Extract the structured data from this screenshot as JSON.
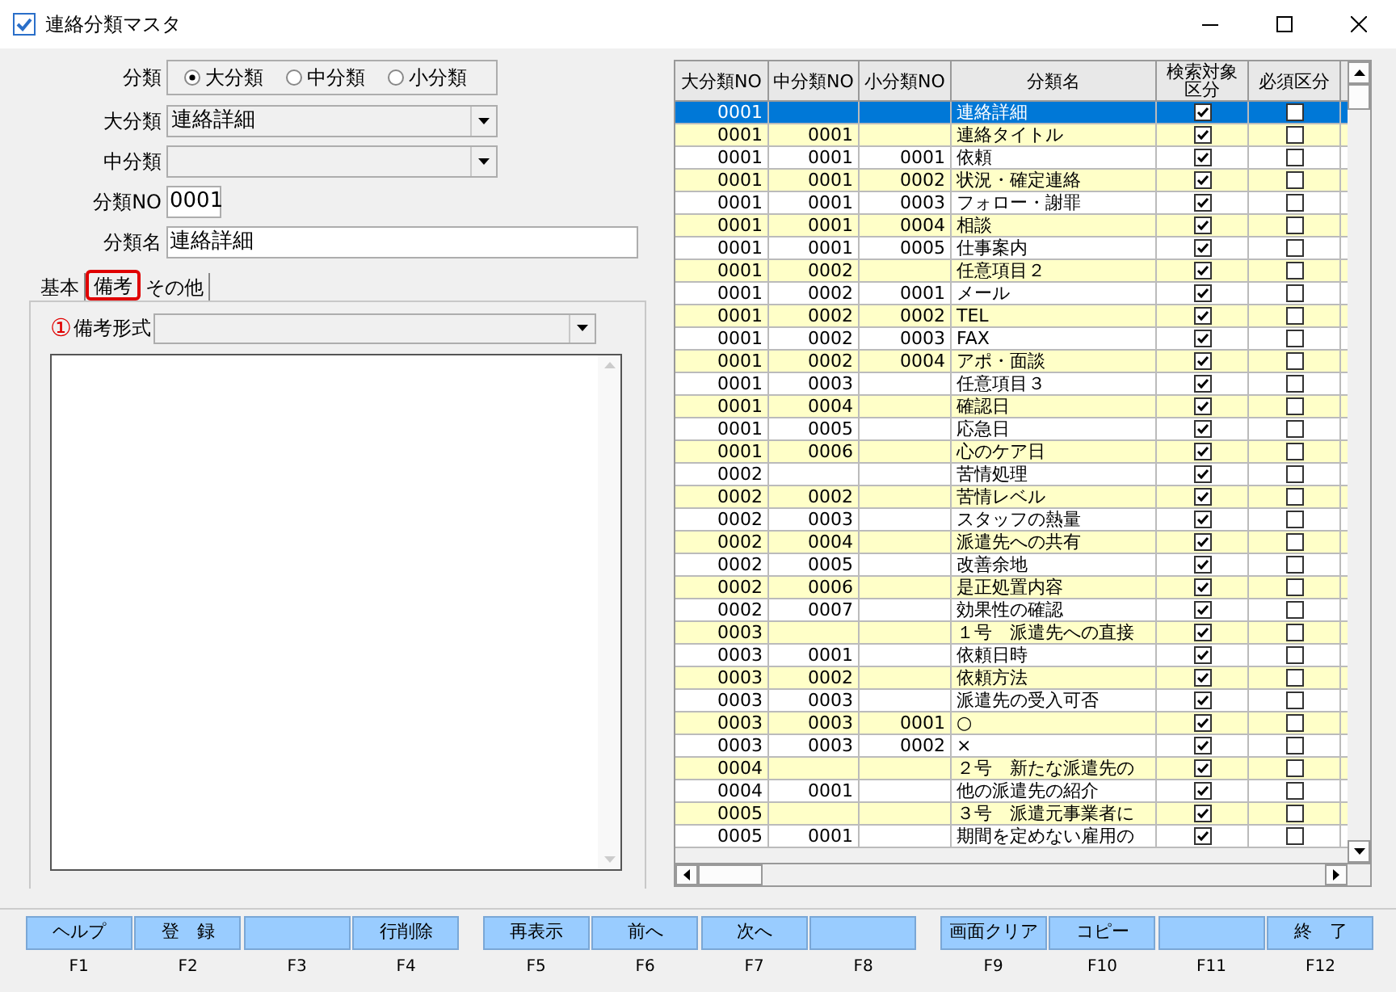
{
  "window": {
    "title": "連絡分類マスタ"
  },
  "form": {
    "category_label": "分類",
    "radios": [
      {
        "label": "大分類",
        "selected": true
      },
      {
        "label": "中分類",
        "selected": false
      },
      {
        "label": "小分類",
        "selected": false
      }
    ],
    "major_label": "大分類",
    "major_value": "連絡詳細",
    "middle_label": "中分類",
    "no_label": "分類NO",
    "no_value": "0001",
    "name_label": "分類名",
    "name_value": "連絡詳細"
  },
  "tabs": [
    {
      "label": "基本",
      "selected": false,
      "annotated": false
    },
    {
      "label": "備考",
      "selected": true,
      "annotated": true
    },
    {
      "label": "その他",
      "selected": false,
      "annotated": false
    }
  ],
  "remarks": {
    "marker": "①",
    "label": "備考形式"
  },
  "table": {
    "columns": [
      "大分類NO",
      "中分類NO",
      "小分類NO",
      "分類名",
      "検索対象区分",
      "必須区分"
    ],
    "rows": [
      {
        "major": "0001",
        "middle": "",
        "minor": "",
        "name": "連絡詳細",
        "search": true,
        "required": false,
        "selected": true
      },
      {
        "major": "0001",
        "middle": "0001",
        "minor": "",
        "name": "連絡タイトル",
        "search": true,
        "required": false,
        "selected": false
      },
      {
        "major": "0001",
        "middle": "0001",
        "minor": "0001",
        "name": "依頼",
        "search": true,
        "required": false,
        "selected": false
      },
      {
        "major": "0001",
        "middle": "0001",
        "minor": "0002",
        "name": "状況・確定連絡",
        "search": true,
        "required": false,
        "selected": false
      },
      {
        "major": "0001",
        "middle": "0001",
        "minor": "0003",
        "name": "フォロー・謝罪",
        "search": true,
        "required": false,
        "selected": false
      },
      {
        "major": "0001",
        "middle": "0001",
        "minor": "0004",
        "name": "相談",
        "search": true,
        "required": false,
        "selected": false
      },
      {
        "major": "0001",
        "middle": "0001",
        "minor": "0005",
        "name": "仕事案内",
        "search": true,
        "required": false,
        "selected": false
      },
      {
        "major": "0001",
        "middle": "0002",
        "minor": "",
        "name": "任意項目２",
        "search": true,
        "required": false,
        "selected": false
      },
      {
        "major": "0001",
        "middle": "0002",
        "minor": "0001",
        "name": "メール",
        "search": true,
        "required": false,
        "selected": false
      },
      {
        "major": "0001",
        "middle": "0002",
        "minor": "0002",
        "name": "TEL",
        "search": true,
        "required": false,
        "selected": false
      },
      {
        "major": "0001",
        "middle": "0002",
        "minor": "0003",
        "name": "FAX",
        "search": true,
        "required": false,
        "selected": false
      },
      {
        "major": "0001",
        "middle": "0002",
        "minor": "0004",
        "name": "アポ・面談",
        "search": true,
        "required": false,
        "selected": false
      },
      {
        "major": "0001",
        "middle": "0003",
        "minor": "",
        "name": "任意項目３",
        "search": true,
        "required": false,
        "selected": false
      },
      {
        "major": "0001",
        "middle": "0004",
        "minor": "",
        "name": "確認日",
        "search": true,
        "required": false,
        "selected": false
      },
      {
        "major": "0001",
        "middle": "0005",
        "minor": "",
        "name": "応急日",
        "search": true,
        "required": false,
        "selected": false
      },
      {
        "major": "0001",
        "middle": "0006",
        "minor": "",
        "name": "心のケア日",
        "search": true,
        "required": false,
        "selected": false
      },
      {
        "major": "0002",
        "middle": "",
        "minor": "",
        "name": "苦情処理",
        "search": true,
        "required": false,
        "selected": false
      },
      {
        "major": "0002",
        "middle": "0002",
        "minor": "",
        "name": "苦情レベル",
        "search": true,
        "required": false,
        "selected": false
      },
      {
        "major": "0002",
        "middle": "0003",
        "minor": "",
        "name": "スタッフの熱量",
        "search": true,
        "required": false,
        "selected": false
      },
      {
        "major": "0002",
        "middle": "0004",
        "minor": "",
        "name": "派遣先への共有",
        "search": true,
        "required": false,
        "selected": false
      },
      {
        "major": "0002",
        "middle": "0005",
        "minor": "",
        "name": "改善余地",
        "search": true,
        "required": false,
        "selected": false
      },
      {
        "major": "0002",
        "middle": "0006",
        "minor": "",
        "name": "是正処置内容",
        "search": true,
        "required": false,
        "selected": false
      },
      {
        "major": "0002",
        "middle": "0007",
        "minor": "",
        "name": "効果性の確認",
        "search": true,
        "required": false,
        "selected": false
      },
      {
        "major": "0003",
        "middle": "",
        "minor": "",
        "name": "１号　派遣先への直接",
        "search": true,
        "required": false,
        "selected": false
      },
      {
        "major": "0003",
        "middle": "0001",
        "minor": "",
        "name": "依頼日時",
        "search": true,
        "required": false,
        "selected": false
      },
      {
        "major": "0003",
        "middle": "0002",
        "minor": "",
        "name": "依頼方法",
        "search": true,
        "required": false,
        "selected": false
      },
      {
        "major": "0003",
        "middle": "0003",
        "minor": "",
        "name": "派遣先の受入可否",
        "search": true,
        "required": false,
        "selected": false
      },
      {
        "major": "0003",
        "middle": "0003",
        "minor": "0001",
        "name": "○",
        "search": true,
        "required": false,
        "selected": false
      },
      {
        "major": "0003",
        "middle": "0003",
        "minor": "0002",
        "name": "×",
        "search": true,
        "required": false,
        "selected": false
      },
      {
        "major": "0004",
        "middle": "",
        "minor": "",
        "name": "２号　新たな派遣先の",
        "search": true,
        "required": false,
        "selected": false
      },
      {
        "major": "0004",
        "middle": "0001",
        "minor": "",
        "name": "他の派遣先の紹介",
        "search": true,
        "required": false,
        "selected": false
      },
      {
        "major": "0005",
        "middle": "",
        "minor": "",
        "name": "３号　派遣元事業者に",
        "search": true,
        "required": false,
        "selected": false
      },
      {
        "major": "0005",
        "middle": "0001",
        "minor": "",
        "name": "期間を定めない雇用の",
        "search": true,
        "required": false,
        "selected": false
      }
    ]
  },
  "function_keys": [
    {
      "label": "ヘルプ",
      "key": "F1"
    },
    {
      "label": "登　録",
      "key": "F2"
    },
    {
      "key": "F3"
    },
    {
      "label": "行削除",
      "key": "F4"
    },
    {
      "label": "再表示",
      "key": "F5"
    },
    {
      "label": "前へ",
      "key": "F6"
    },
    {
      "label": "次へ",
      "key": "F7"
    },
    {
      "key": "F8"
    },
    {
      "label": "画面クリア",
      "key": "F9"
    },
    {
      "label": "コピー",
      "key": "F10"
    },
    {
      "key": "F11"
    },
    {
      "label": "終　了",
      "key": "F12"
    }
  ]
}
